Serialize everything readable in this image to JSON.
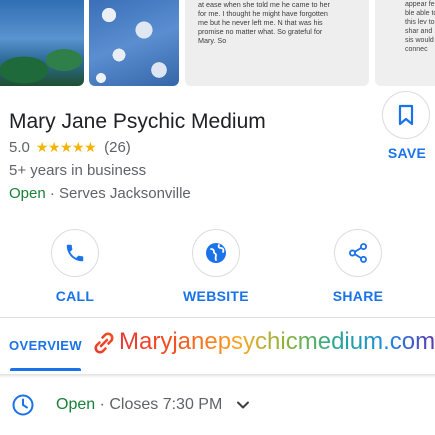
{
  "photos": {
    "review_text": "at ease when she told me he came to her for me. I thought he might have forgotten me but he never left me. N that was his promise no matter what. So grateful for Mary. So",
    "review_text_partial": "appear feel ble able to this lev to shar and sis would b connec"
  },
  "business": {
    "name": "Mary Jane Psychic Medium",
    "rating": "5.0",
    "stars": "★★★★★",
    "review_count": "(26)",
    "years": "5+ years in business",
    "open_status": "Open",
    "serves": " · Serves Jacksonville"
  },
  "save": {
    "label": "SAVE",
    "icon": "bookmark-icon"
  },
  "actions": [
    {
      "label": "CALL",
      "icon": "phone-icon"
    },
    {
      "label": "WEBSITE",
      "icon": "globe-icon"
    },
    {
      "label": "SHARE",
      "icon": "share-icon"
    }
  ],
  "tabs": {
    "overview": "OVERVIEW",
    "website_link": "Maryjanepsychicmedium.com",
    "link_icon": "link-icon"
  },
  "hours": {
    "status": "Open",
    "separator": " · ",
    "closes": "Closes 7:30 PM",
    "icon": "clock-icon"
  },
  "colors": {
    "accent": "#1a73e8",
    "open_green": "#188038",
    "star": "#f4b400"
  }
}
